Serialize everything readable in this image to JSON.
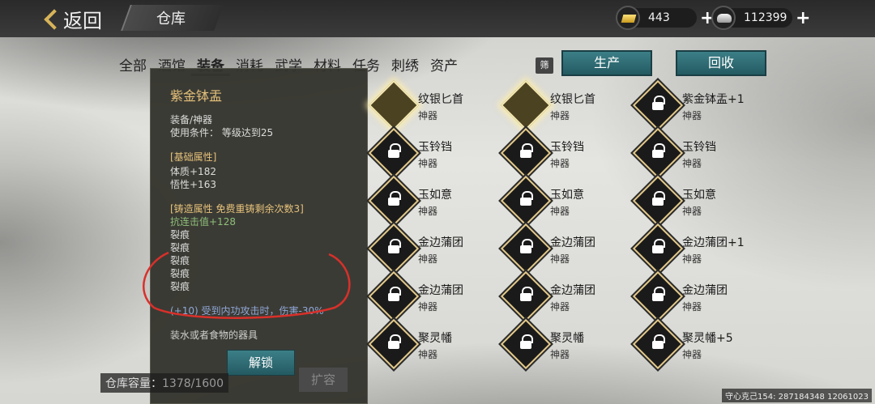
{
  "header": {
    "back_label": "返回",
    "title": "仓库",
    "gold_amount": "443",
    "silver_amount": "112399"
  },
  "tabs": [
    "全部",
    "酒馆",
    "装备",
    "消耗",
    "武学",
    "材料",
    "任务",
    "刺绣",
    "资产"
  ],
  "active_tab": "装备",
  "filter_label": "筛",
  "buttons": {
    "produce": "生产",
    "recycle": "回收",
    "unlock": "解锁",
    "expand": "扩容"
  },
  "items": [
    {
      "name": "纹银匕首",
      "type": "神器",
      "icon": "dagger-icon",
      "locked": false,
      "bright": true
    },
    {
      "name": "纹银匕首",
      "type": "神器",
      "icon": "dagger-icon",
      "locked": false,
      "bright": true
    },
    {
      "name": "紫金钵盂+1",
      "type": "神器",
      "icon": "bowl-icon",
      "locked": true,
      "bright": false
    },
    {
      "name": "玉铃铛",
      "type": "神器",
      "icon": "bell-icon",
      "locked": true,
      "bright": false
    },
    {
      "name": "玉铃铛",
      "type": "神器",
      "icon": "bell-icon",
      "locked": true,
      "bright": false
    },
    {
      "name": "玉铃铛",
      "type": "神器",
      "icon": "bell-icon",
      "locked": true,
      "bright": false
    },
    {
      "name": "玉如意",
      "type": "神器",
      "icon": "ruyi-icon",
      "locked": true,
      "bright": false
    },
    {
      "name": "玉如意",
      "type": "神器",
      "icon": "ruyi-icon",
      "locked": true,
      "bright": false
    },
    {
      "name": "玉如意",
      "type": "神器",
      "icon": "ruyi-icon",
      "locked": true,
      "bright": false
    },
    {
      "name": "金边蒲团",
      "type": "神器",
      "icon": "cushion-icon",
      "locked": true,
      "bright": false
    },
    {
      "name": "金边蒲团",
      "type": "神器",
      "icon": "cushion-icon",
      "locked": true,
      "bright": false
    },
    {
      "name": "金边蒲团+1",
      "type": "神器",
      "icon": "cushion-icon",
      "locked": true,
      "bright": false
    },
    {
      "name": "金边蒲团",
      "type": "神器",
      "icon": "cushion-icon",
      "locked": true,
      "bright": false
    },
    {
      "name": "金边蒲团",
      "type": "神器",
      "icon": "cushion-icon",
      "locked": true,
      "bright": false
    },
    {
      "name": "金边蒲团",
      "type": "神器",
      "icon": "cushion-icon",
      "locked": true,
      "bright": false
    },
    {
      "name": "聚灵幡",
      "type": "神器",
      "icon": "banner-icon",
      "locked": true,
      "bright": false
    },
    {
      "name": "聚灵幡",
      "type": "神器",
      "icon": "banner-icon",
      "locked": true,
      "bright": false
    },
    {
      "name": "聚灵幡+5",
      "type": "神器",
      "icon": "banner-icon",
      "locked": true,
      "bright": false
    }
  ],
  "tooltip": {
    "name": "紫金钵盂",
    "category": "装备/神器",
    "requirement": "使用条件：  等级达到25",
    "base_header": "[基础属性]",
    "base_stats": [
      "体质+182",
      "悟性+163"
    ],
    "forge_header": "[铸造属性  免费重铸剩余次数3]",
    "forge_stat": "抗连击值+128",
    "cracks": [
      "裂痕",
      "裂痕",
      "裂痕",
      "裂痕",
      "裂痕"
    ],
    "special": "(+10) 受到内功攻击时，伤害-30%",
    "description": "装水或者食物的器具"
  },
  "storage": {
    "label": "仓库容量：",
    "value": "1378/1600"
  },
  "footer_text": "守心克己154: 287184348  12061023",
  "colors": {
    "accent_teal": "#2f6e76",
    "gold_text": "#e5c17a",
    "annotation_red": "#d9302a"
  }
}
